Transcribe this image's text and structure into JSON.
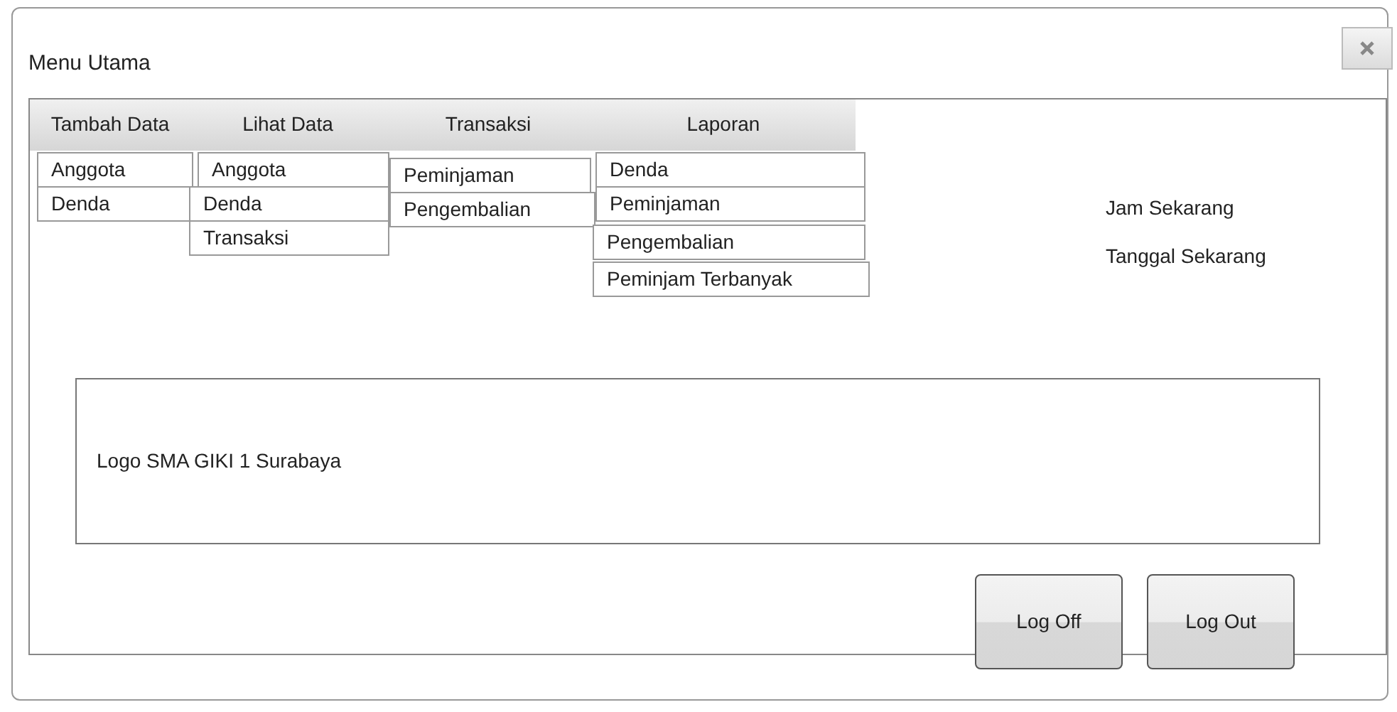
{
  "window": {
    "title": "Menu Utama"
  },
  "menus": [
    {
      "label": "Tambah Data",
      "items": [
        "Anggota",
        "Denda"
      ]
    },
    {
      "label": "Lihat Data",
      "items": [
        "Anggota",
        "Denda",
        "Transaksi"
      ]
    },
    {
      "label": "Transaksi",
      "items": [
        "Peminjaman",
        "Pengembalian"
      ]
    },
    {
      "label": "Laporan",
      "items": [
        "Denda",
        "Peminjaman",
        "Pengembalian",
        "Peminjam Terbanyak"
      ]
    }
  ],
  "info_labels": [
    "Jam Sekarang",
    "Tanggal Sekarang"
  ],
  "logo_box": {
    "text": "Logo SMA GIKI 1 Surabaya"
  },
  "buttons": [
    "Log Off",
    "Log Out"
  ]
}
